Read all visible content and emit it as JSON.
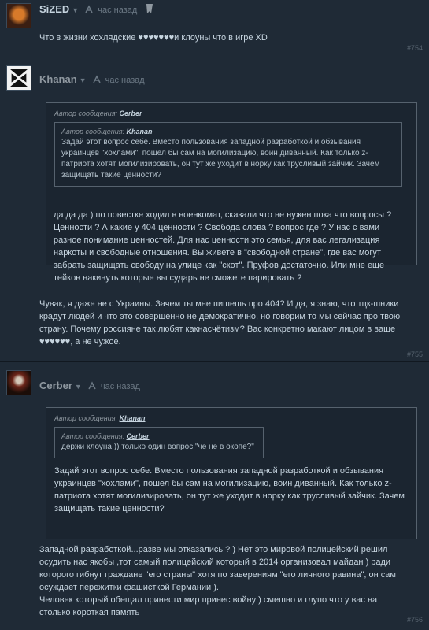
{
  "comments": [
    {
      "author": "SiZED",
      "time": "час назад",
      "text": "Что в жизни хохлядские ♥♥♥♥♥♥♥и клоуны что в игре XD",
      "number": "#754"
    },
    {
      "author": "Khanan",
      "time": "час назад",
      "quote_header": "Автор сообщения:",
      "quote_author": "Cerber",
      "inner_quote_header": "Автор сообщения:",
      "inner_quote_author": "Khanan",
      "inner_quote_text": "Задай этот вопрос себе. Вместо пользования западной разработкой и обзывания украинцев \"хохлами\", пошел бы сам на могилизацию, воин диванный. Как только z-патриота хотят могилизировать, он тут же уходит в норку как трусливый зайчик. Зачем защищать такие ценности?",
      "quote_text": "да да да ) по повестке ходил в военкомат, сказали что не нужен пока что вопросы ? Ценности ? А какие у 404 ценности ? Свобода слова ? вопрос где ? У нас с вами разное понимание ценностей. Для нас ценности это семья, для вас легализация наркоты и свободные отношения. Вы живете в \"свободной стране\", где вас могут забрать защищать свободу на улице как \"скот\". Пруфов достаточно. Или мне еще тейков накинуть которые вы сударь не сможете парировать ?",
      "text": "Чувак, я даже не с Украины. Зачем ты мне пишешь про 404? И да, я знаю, что тцк-шники крадут людей и что это совершенно не демократично, но говорим то мы сейчас про твою страну. Почему россияне так любят какнасчётизм? Вас конкретно макают лицом в ваше ♥♥♥♥♥♥, а не чужое.",
      "number": "#755"
    },
    {
      "author": "Cerber",
      "time": "час назад",
      "quote_header": "Автор сообщения:",
      "quote_author": "Khanan",
      "inner_quote_header": "Автор сообщения:",
      "inner_quote_author": "Cerber",
      "inner_quote_text": "держи клоуна )) только один вопрос \"че не в окопе?\"",
      "quote_text": "Задай этот вопрос себе. Вместо пользования западной разработкой и обзывания украинцев \"хохлами\", пошел бы сам на могилизацию, воин диванный. Как только z-патриота хотят могилизировать, он тут же уходит в норку как трусливый зайчик. Зачем защищать такие ценности?",
      "text": "Западной разработкой...разве мы отказались ? ) Нет это мировой полицейский решил осудить нас якобы ,тот самый полицейский который в 2014 организовал майдан ) ради которого гибнут граждане \"его страны\" хотя по заверениям \"его личного равина\", он сам осуждает пережитки фашисткой Германии ).\nЧеловек который обещал принести мир принес войну ) смешно и глупо что у вас на столько короткая память",
      "number": "#756"
    }
  ]
}
